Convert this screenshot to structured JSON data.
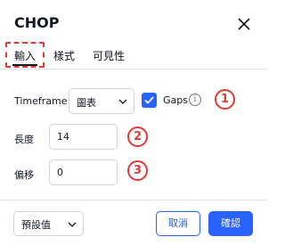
{
  "dialog": {
    "title": "CHOP",
    "close_icon": "close-icon"
  },
  "tabs": [
    {
      "label": "輸入",
      "active": true
    },
    {
      "label": "樣式",
      "active": false
    },
    {
      "label": "可見性",
      "active": false
    }
  ],
  "inputs": {
    "timeframe_label": "Timeframe",
    "timeframe_value": "圖表",
    "gaps_label": "Gaps",
    "gaps_checked": true,
    "info_icon_glyph": "i",
    "length_label": "長度",
    "length_value": "14",
    "offset_label": "偏移",
    "offset_value": "0"
  },
  "annotations": [
    "1",
    "2",
    "3"
  ],
  "footer": {
    "defaults_label": "預設值",
    "cancel_label": "取消",
    "ok_label": "確認"
  },
  "colors": {
    "accent": "#2962ff",
    "annotation": "#e53935",
    "border": "#d1d4dc",
    "text": "#131722"
  }
}
